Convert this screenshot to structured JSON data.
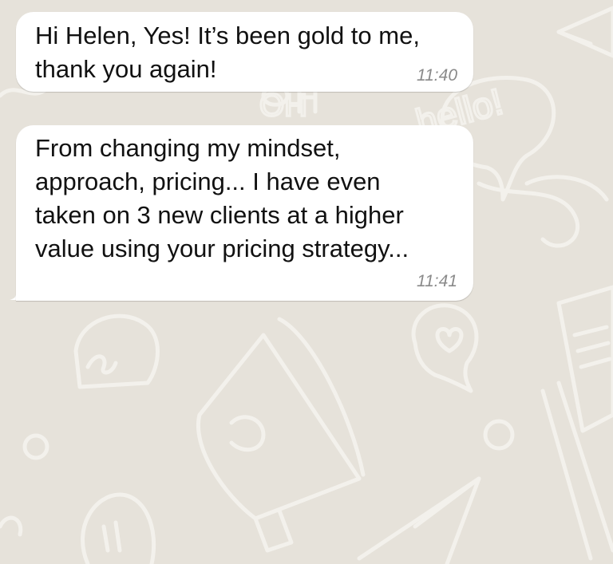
{
  "background": {
    "color": "#e6e2da",
    "doodle_color": "#f3f1ec",
    "doodle_words": [
      "OH",
      "hello!"
    ]
  },
  "messages": [
    {
      "text": "Hi Helen, Yes! It’s been gold to me,\nthank you again!",
      "time": "11:40"
    },
    {
      "text": "From changing my mindset,\napproach, pricing... I have even\ntaken on 3 new clients at a higher\nvalue using your pricing strategy...",
      "time": "11:41"
    }
  ]
}
